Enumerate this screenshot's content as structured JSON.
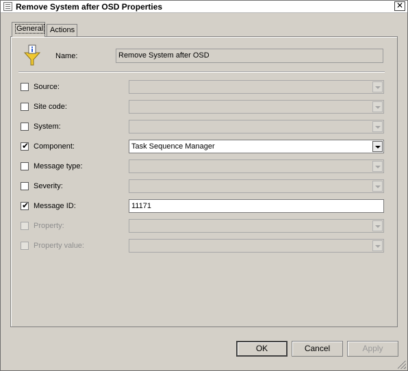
{
  "window": {
    "title": "Remove System after OSD Properties",
    "close": "✕"
  },
  "tabs": [
    {
      "label": "General",
      "active": true
    },
    {
      "label": "Actions",
      "active": false
    }
  ],
  "general": {
    "name_label": "Name:",
    "name_value": "Remove System after OSD",
    "criteria": [
      {
        "label": "Source:",
        "checked": false,
        "enabled": true,
        "value": "",
        "control": "combo"
      },
      {
        "label": "Site code:",
        "checked": false,
        "enabled": true,
        "value": "",
        "control": "combo"
      },
      {
        "label": "System:",
        "checked": false,
        "enabled": true,
        "value": "",
        "control": "combo"
      },
      {
        "label": "Component:",
        "checked": true,
        "enabled": true,
        "value": "Task Sequence Manager",
        "control": "combo"
      },
      {
        "label": "Message type:",
        "checked": false,
        "enabled": true,
        "value": "",
        "control": "combo"
      },
      {
        "label": "Severity:",
        "checked": false,
        "enabled": true,
        "value": "",
        "control": "combo"
      },
      {
        "label": "Message ID:",
        "checked": true,
        "enabled": true,
        "value": "11171",
        "control": "text"
      },
      {
        "label": "Property:",
        "checked": false,
        "enabled": false,
        "value": "",
        "control": "combo"
      },
      {
        "label": "Property value:",
        "checked": false,
        "enabled": false,
        "value": "",
        "control": "combo"
      }
    ]
  },
  "buttons": {
    "ok": "OK",
    "cancel": "Cancel",
    "apply": "Apply"
  },
  "icons": {
    "title": "properties-window-icon",
    "filter": "filter-funnel-info-icon",
    "check": "✔"
  }
}
